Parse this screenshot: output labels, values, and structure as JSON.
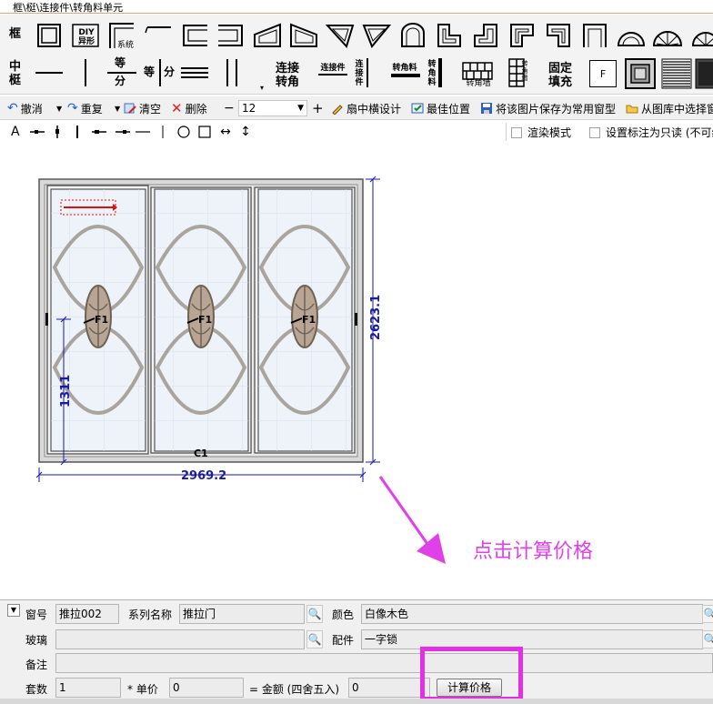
{
  "breadcrumb": "框\\梃\\连接件\\转角料单元",
  "palette": {
    "row1_label": "框",
    "row2_label": "中\n梃",
    "diy_label": "DIY\n异形",
    "system_label": "系统",
    "equal_label": "等",
    "divide_label": "分",
    "equal_divide_label": "等 分",
    "connect_corner_label": "连接\n转角",
    "connector_label": "连接件",
    "connector_vertical_label": "连\n接\n件",
    "corner_material_label": "转角料",
    "corner_material_vertical_label": "转\n角\n料",
    "corner_wall_label": "转角墙",
    "corner_wall_vertical_label": "转\n角\n墙",
    "fixed_fill_label": "固定\n填充",
    "fill_f_label": "F"
  },
  "toolbar": {
    "undo_label": "撤消",
    "redo_label": "重复",
    "clear_label": "清空",
    "delete_label": "删除",
    "size_value": "12",
    "sash_design_label": "扇中横设计",
    "best_position_label": "最佳位置",
    "save_window_label": "将该图片保存为常用窗型",
    "from_library_label": "从图库中选择窗"
  },
  "drawbar": {
    "text_tool": "A",
    "render_mode_label": "渲染模式",
    "readonly_label": "设置标注为只读 (不可编"
  },
  "drawing": {
    "window_code": "C1",
    "sash_label": "F1",
    "width_dim": "2969.2",
    "height_dim": "2623.1",
    "handle_height_dim": "1311"
  },
  "annotation": {
    "hint": "点击计算价格"
  },
  "form": {
    "window_no_label": "窗号",
    "window_no_value": "推拉002",
    "series_label": "系列名称",
    "series_value": "推拉门",
    "color_label": "颜色",
    "color_value": "白像木色",
    "glass_label": "玻璃",
    "glass_value": "",
    "hardware_label": "配件",
    "hardware_value": "一字锁",
    "remark_label": "备注",
    "remark_value": "",
    "sets_label": "套数",
    "sets_value": "1",
    "unit_price_label": "* 单价",
    "unit_price_value": "0",
    "amount_label": "= 金额 (四舍五入)",
    "amount_value": "0",
    "calc_button": "计算价格"
  },
  "colors": {
    "dimension": "#1a1aa8",
    "highlight": "#e32fe6",
    "annotation_red": "#e01010"
  }
}
